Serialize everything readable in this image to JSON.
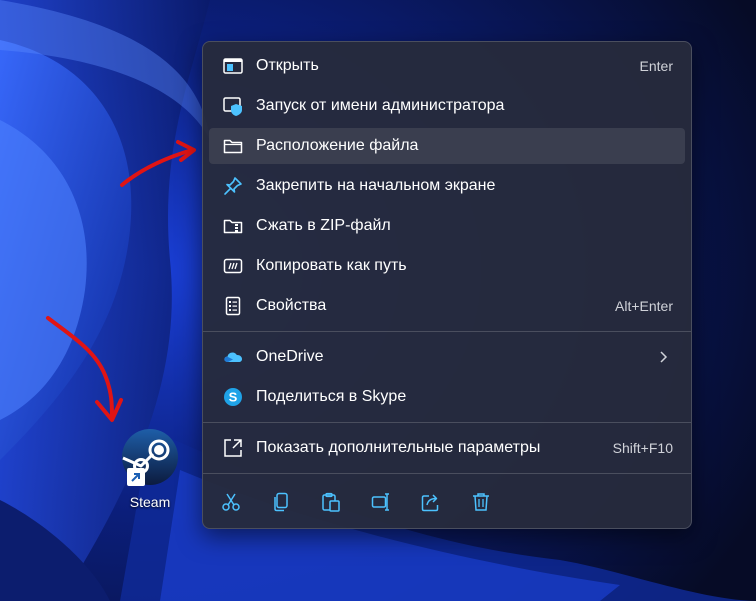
{
  "desktop": {
    "shortcut": {
      "label": "Steam",
      "icon": "steam-icon"
    }
  },
  "context_menu": {
    "items": [
      {
        "label": "Открыть",
        "shortcut": "Enter",
        "icon": "open-window-icon"
      },
      {
        "label": "Запуск от имени администратора",
        "icon": "shield-admin-icon"
      },
      {
        "label": "Расположение файла",
        "icon": "folder-icon",
        "highlighted": true
      },
      {
        "label": "Закрепить на начальном экране",
        "icon": "pin-icon"
      },
      {
        "label": "Сжать в ZIP-файл",
        "icon": "zip-folder-icon"
      },
      {
        "label": "Копировать как путь",
        "icon": "copy-path-icon"
      },
      {
        "label": "Свойства",
        "shortcut": "Alt+Enter",
        "icon": "properties-icon"
      },
      {
        "label": "OneDrive",
        "icon": "onedrive-icon",
        "submenu": true
      },
      {
        "label": "Поделиться в Skype",
        "icon": "skype-icon"
      },
      {
        "label": "Показать дополнительные параметры",
        "shortcut": "Shift+F10",
        "icon": "show-more-icon"
      }
    ],
    "bottom_bar": [
      "cut-icon",
      "copy-icon",
      "paste-icon",
      "rename-icon",
      "share-icon",
      "delete-icon"
    ]
  },
  "colors": {
    "menu_bg": "#272b3c",
    "hover_bg": "#3a3e4f",
    "accent": "#4cc2ff",
    "annotation_red": "#e01414"
  }
}
